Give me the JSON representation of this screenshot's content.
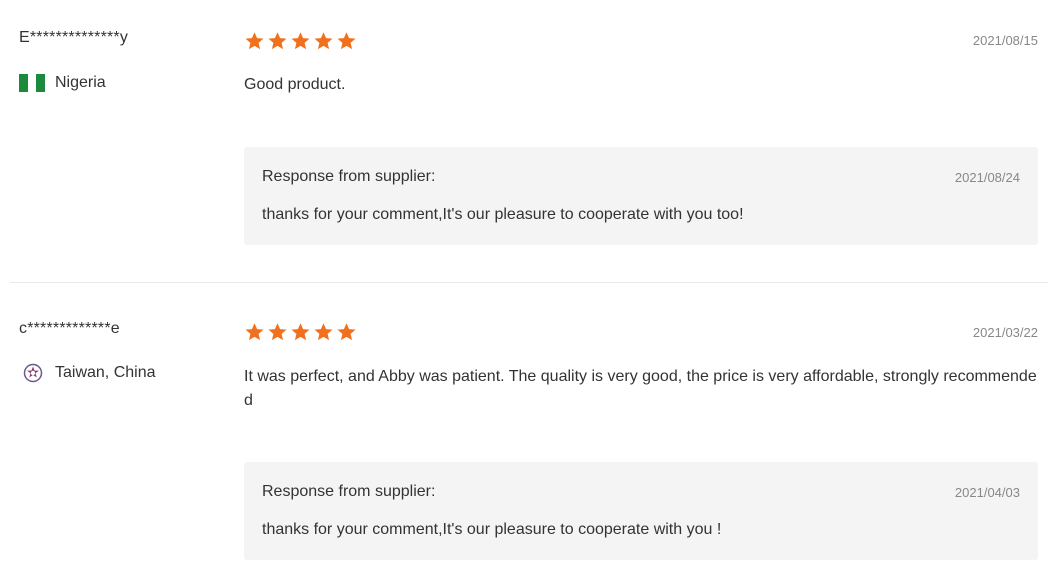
{
  "reviews": [
    {
      "user": "E**************y",
      "country": "Nigeria",
      "flag_icon": "nigeria-flag-icon",
      "rating": 5,
      "date": "2021/08/15",
      "comment": "Good product.",
      "response": {
        "title": "Response from supplier:",
        "date": "2021/08/24",
        "text": "thanks for your comment,It's our pleasure to cooperate with you too!"
      }
    },
    {
      "user": "c*************e",
      "country": "Taiwan, China",
      "flag_icon": "taiwan-region-icon",
      "rating": 5,
      "date": "2021/03/22",
      "comment": "It was perfect, and Abby was patient. The quality is very good, the price is very affordable, strongly recommended",
      "response": {
        "title": "Response from supplier:",
        "date": "2021/04/03",
        "text": "thanks for your comment,It's our pleasure to cooperate with you !"
      }
    }
  ],
  "colors": {
    "star": "#f0701e",
    "response_bg": "#f4f4f4",
    "divider": "#e9e9e9"
  }
}
